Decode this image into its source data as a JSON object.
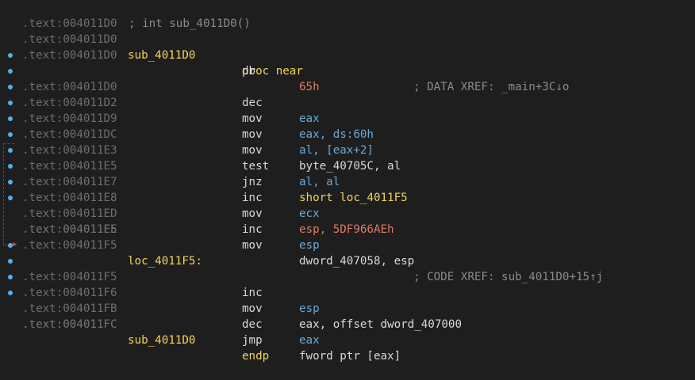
{
  "listing": {
    "header": {
      "address": ".text:004011D0",
      "comment": "; int sub_4011D0()"
    },
    "rows": [
      {
        "addr": ".text:004011D0",
        "label": "sub_4011D0",
        "mnem": "proc near",
        "ops": "",
        "comment": "; DATA XREF: _main+3C↓o",
        "dot": false
      },
      {
        "addr": ".text:004011D0",
        "label": "",
        "mnem": "db",
        "ops": "65h",
        "comment": "",
        "dot": false
      },
      {
        "addr": ".text:004011D0",
        "label": "",
        "mnem": "dec",
        "ops": "eax",
        "comment": "",
        "dot": true
      },
      {
        "addr": ".text:004011D2",
        "label": "",
        "mnem": "mov",
        "ops": "eax, ds:60h",
        "comment": "",
        "dot": true
      },
      {
        "addr": ".text:004011D9",
        "label": "",
        "mnem": "mov",
        "ops": "al, [eax+2]",
        "comment": "",
        "dot": true
      },
      {
        "addr": ".text:004011DC",
        "label": "",
        "mnem": "mov",
        "ops": "byte_40705C, al",
        "comment": "",
        "dot": true
      },
      {
        "addr": ".text:004011E3",
        "label": "",
        "mnem": "test",
        "ops": "al, al",
        "comment": "",
        "dot": true
      },
      {
        "addr": ".text:004011E5",
        "label": "",
        "mnem": "jnz",
        "ops": "short loc_4011F5",
        "comment": "",
        "dot": true
      },
      {
        "addr": ".text:004011E7",
        "label": "",
        "mnem": "inc",
        "ops": "ecx",
        "comment": "",
        "dot": true
      },
      {
        "addr": ".text:004011E8",
        "label": "",
        "mnem": "mov",
        "ops": "esp, 5DF966AEh",
        "comment": "",
        "dot": true
      },
      {
        "addr": ".text:004011ED",
        "label": "",
        "mnem": "inc",
        "ops": "esp",
        "comment": "",
        "dot": true
      },
      {
        "addr": ".text:004011EE",
        "label": "",
        "mnem": "mov",
        "ops": "dword_407058, esp",
        "comment": "",
        "dot": true
      },
      {
        "addr": ".text:004011F5",
        "label": "",
        "mnem": "",
        "ops": "",
        "comment": "",
        "dot": false
      },
      {
        "addr": ".text:004011F5",
        "label": "loc_4011F5:",
        "mnem": "",
        "ops": "",
        "comment": "; CODE XREF: sub_4011D0+15↑j",
        "dot": false
      },
      {
        "addr": ".text:004011F5",
        "label": "",
        "mnem": "inc",
        "ops": "esp",
        "comment": "",
        "dot": true
      },
      {
        "addr": ".text:004011F6",
        "label": "",
        "mnem": "mov",
        "ops": "eax, offset dword_407000",
        "comment": "",
        "dot": true
      },
      {
        "addr": ".text:004011FB",
        "label": "",
        "mnem": "dec",
        "ops": "eax",
        "comment": "",
        "dot": true
      },
      {
        "addr": ".text:004011FC",
        "label": "",
        "mnem": "jmp",
        "ops": "fword ptr [eax]",
        "comment": "",
        "dot": true
      },
      {
        "addr": ".text:004011FC",
        "label": "sub_4011D0",
        "mnem": "endp",
        "ops": "",
        "comment": "",
        "dot": false
      }
    ]
  },
  "colors": {
    "background": "#1e1e1e",
    "address": "#6e6e6e",
    "label": "#f2d35b",
    "mnemonic": "#d8d8d8",
    "register": "#6aa9d6",
    "number": "#e07a5f",
    "comment": "#8a8a8a",
    "breakpoint_dot": "#4fb2e8",
    "jump_arrow": "#8b3a3a"
  }
}
